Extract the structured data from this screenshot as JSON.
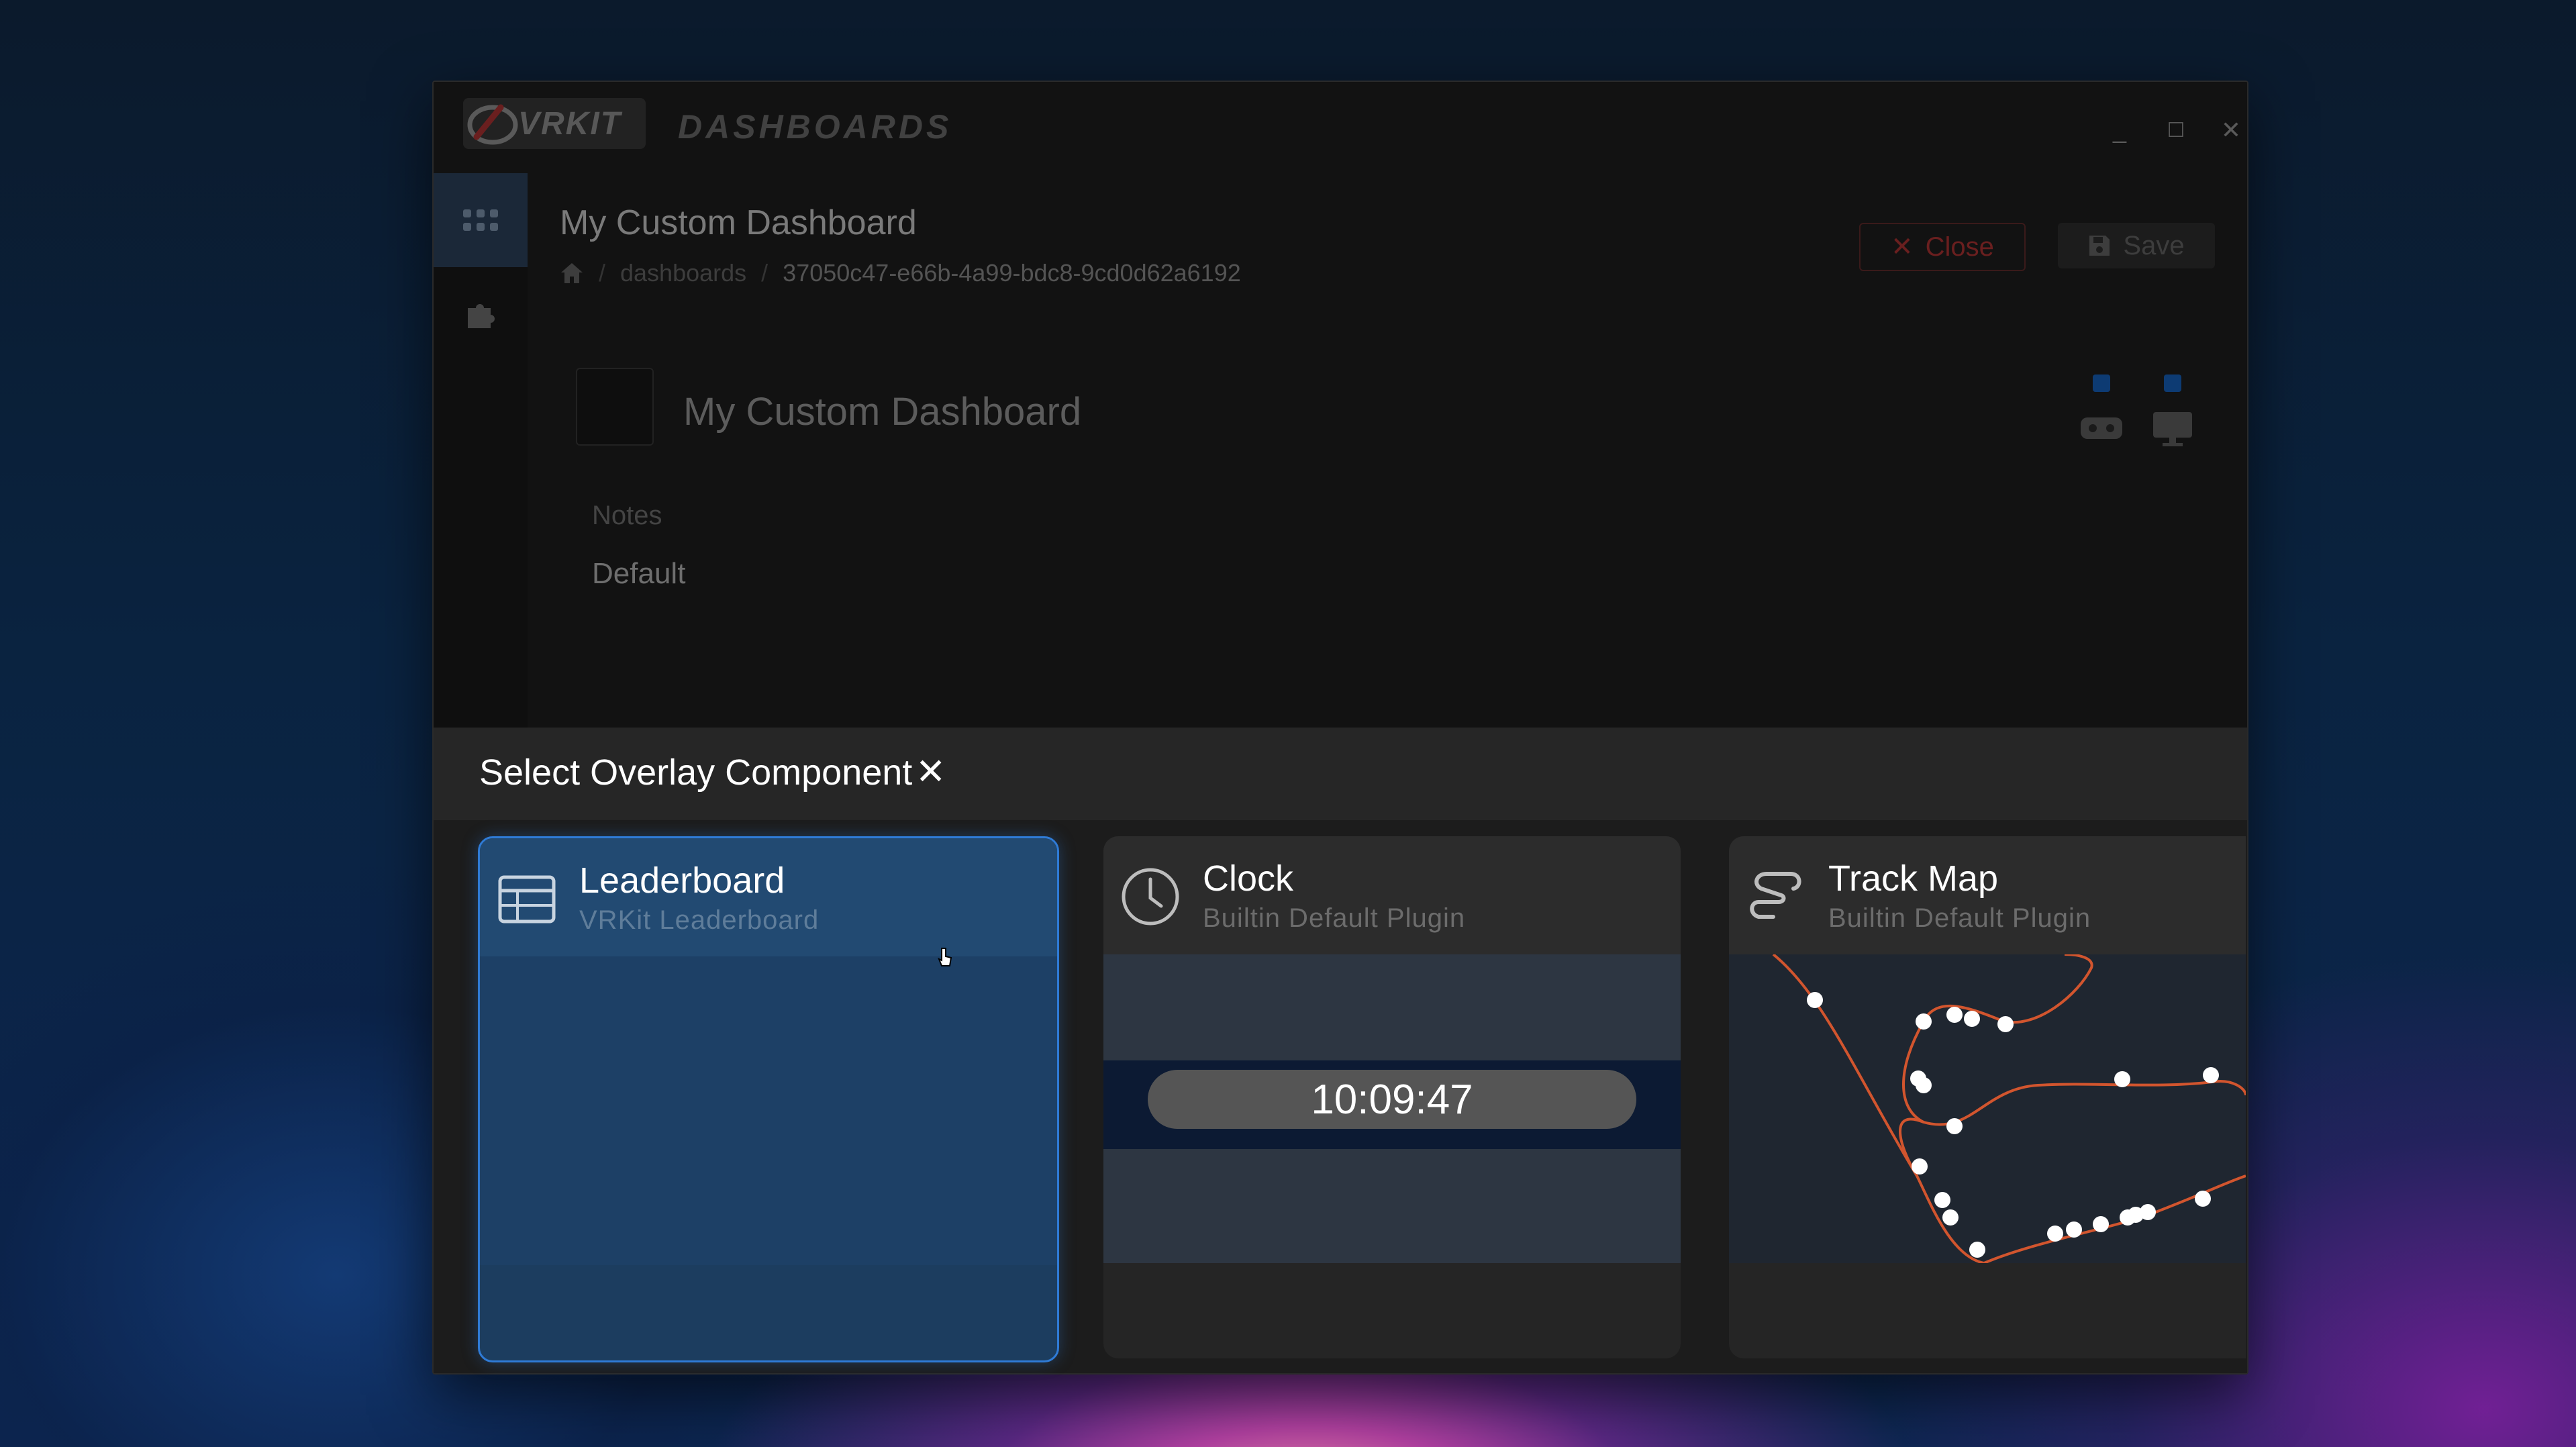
{
  "app": {
    "logo_text": "VRKIT",
    "name": "DASHBOARDS",
    "window_controls": {
      "minimize": "_",
      "maximize": "☐",
      "close": "✕"
    }
  },
  "colors": {
    "accent": "#2f7bd6",
    "close_red": "#6a1f1f",
    "checkbox": "#0d3b73"
  },
  "sidebar": {
    "items": [
      {
        "icon": "grid-icon",
        "active": true
      },
      {
        "icon": "puzzle-icon",
        "active": false
      }
    ]
  },
  "page": {
    "title": "My Custom Dashboard",
    "breadcrumb": {
      "home_icon": "home-icon",
      "sep": "/",
      "segment": "dashboards",
      "current": "37050c47-e66b-4a99-bdc8-9cd0d62a6192"
    },
    "buttons": {
      "close_label": "Close",
      "save_label": "Save"
    }
  },
  "dashboard": {
    "name": "My Custom Dashboard",
    "notes_label": "Notes",
    "notes_value": "Default",
    "targets": [
      {
        "icon": "vr-headset-icon",
        "checked": true
      },
      {
        "icon": "monitor-icon",
        "checked": true
      }
    ]
  },
  "overlay": {
    "title": "Select Overlay Component",
    "close": "✕",
    "components": [
      {
        "title": "Leaderboard",
        "subtitle": "VRKit Leaderboard",
        "icon": "table-icon",
        "selected": true
      },
      {
        "title": "Clock",
        "subtitle": "Builtin Default Plugin",
        "icon": "clock-icon",
        "preview_time": "10:09:47"
      },
      {
        "title": "Track Map",
        "subtitle": "Builtin Default Plugin",
        "icon": "track-map-icon"
      }
    ]
  }
}
